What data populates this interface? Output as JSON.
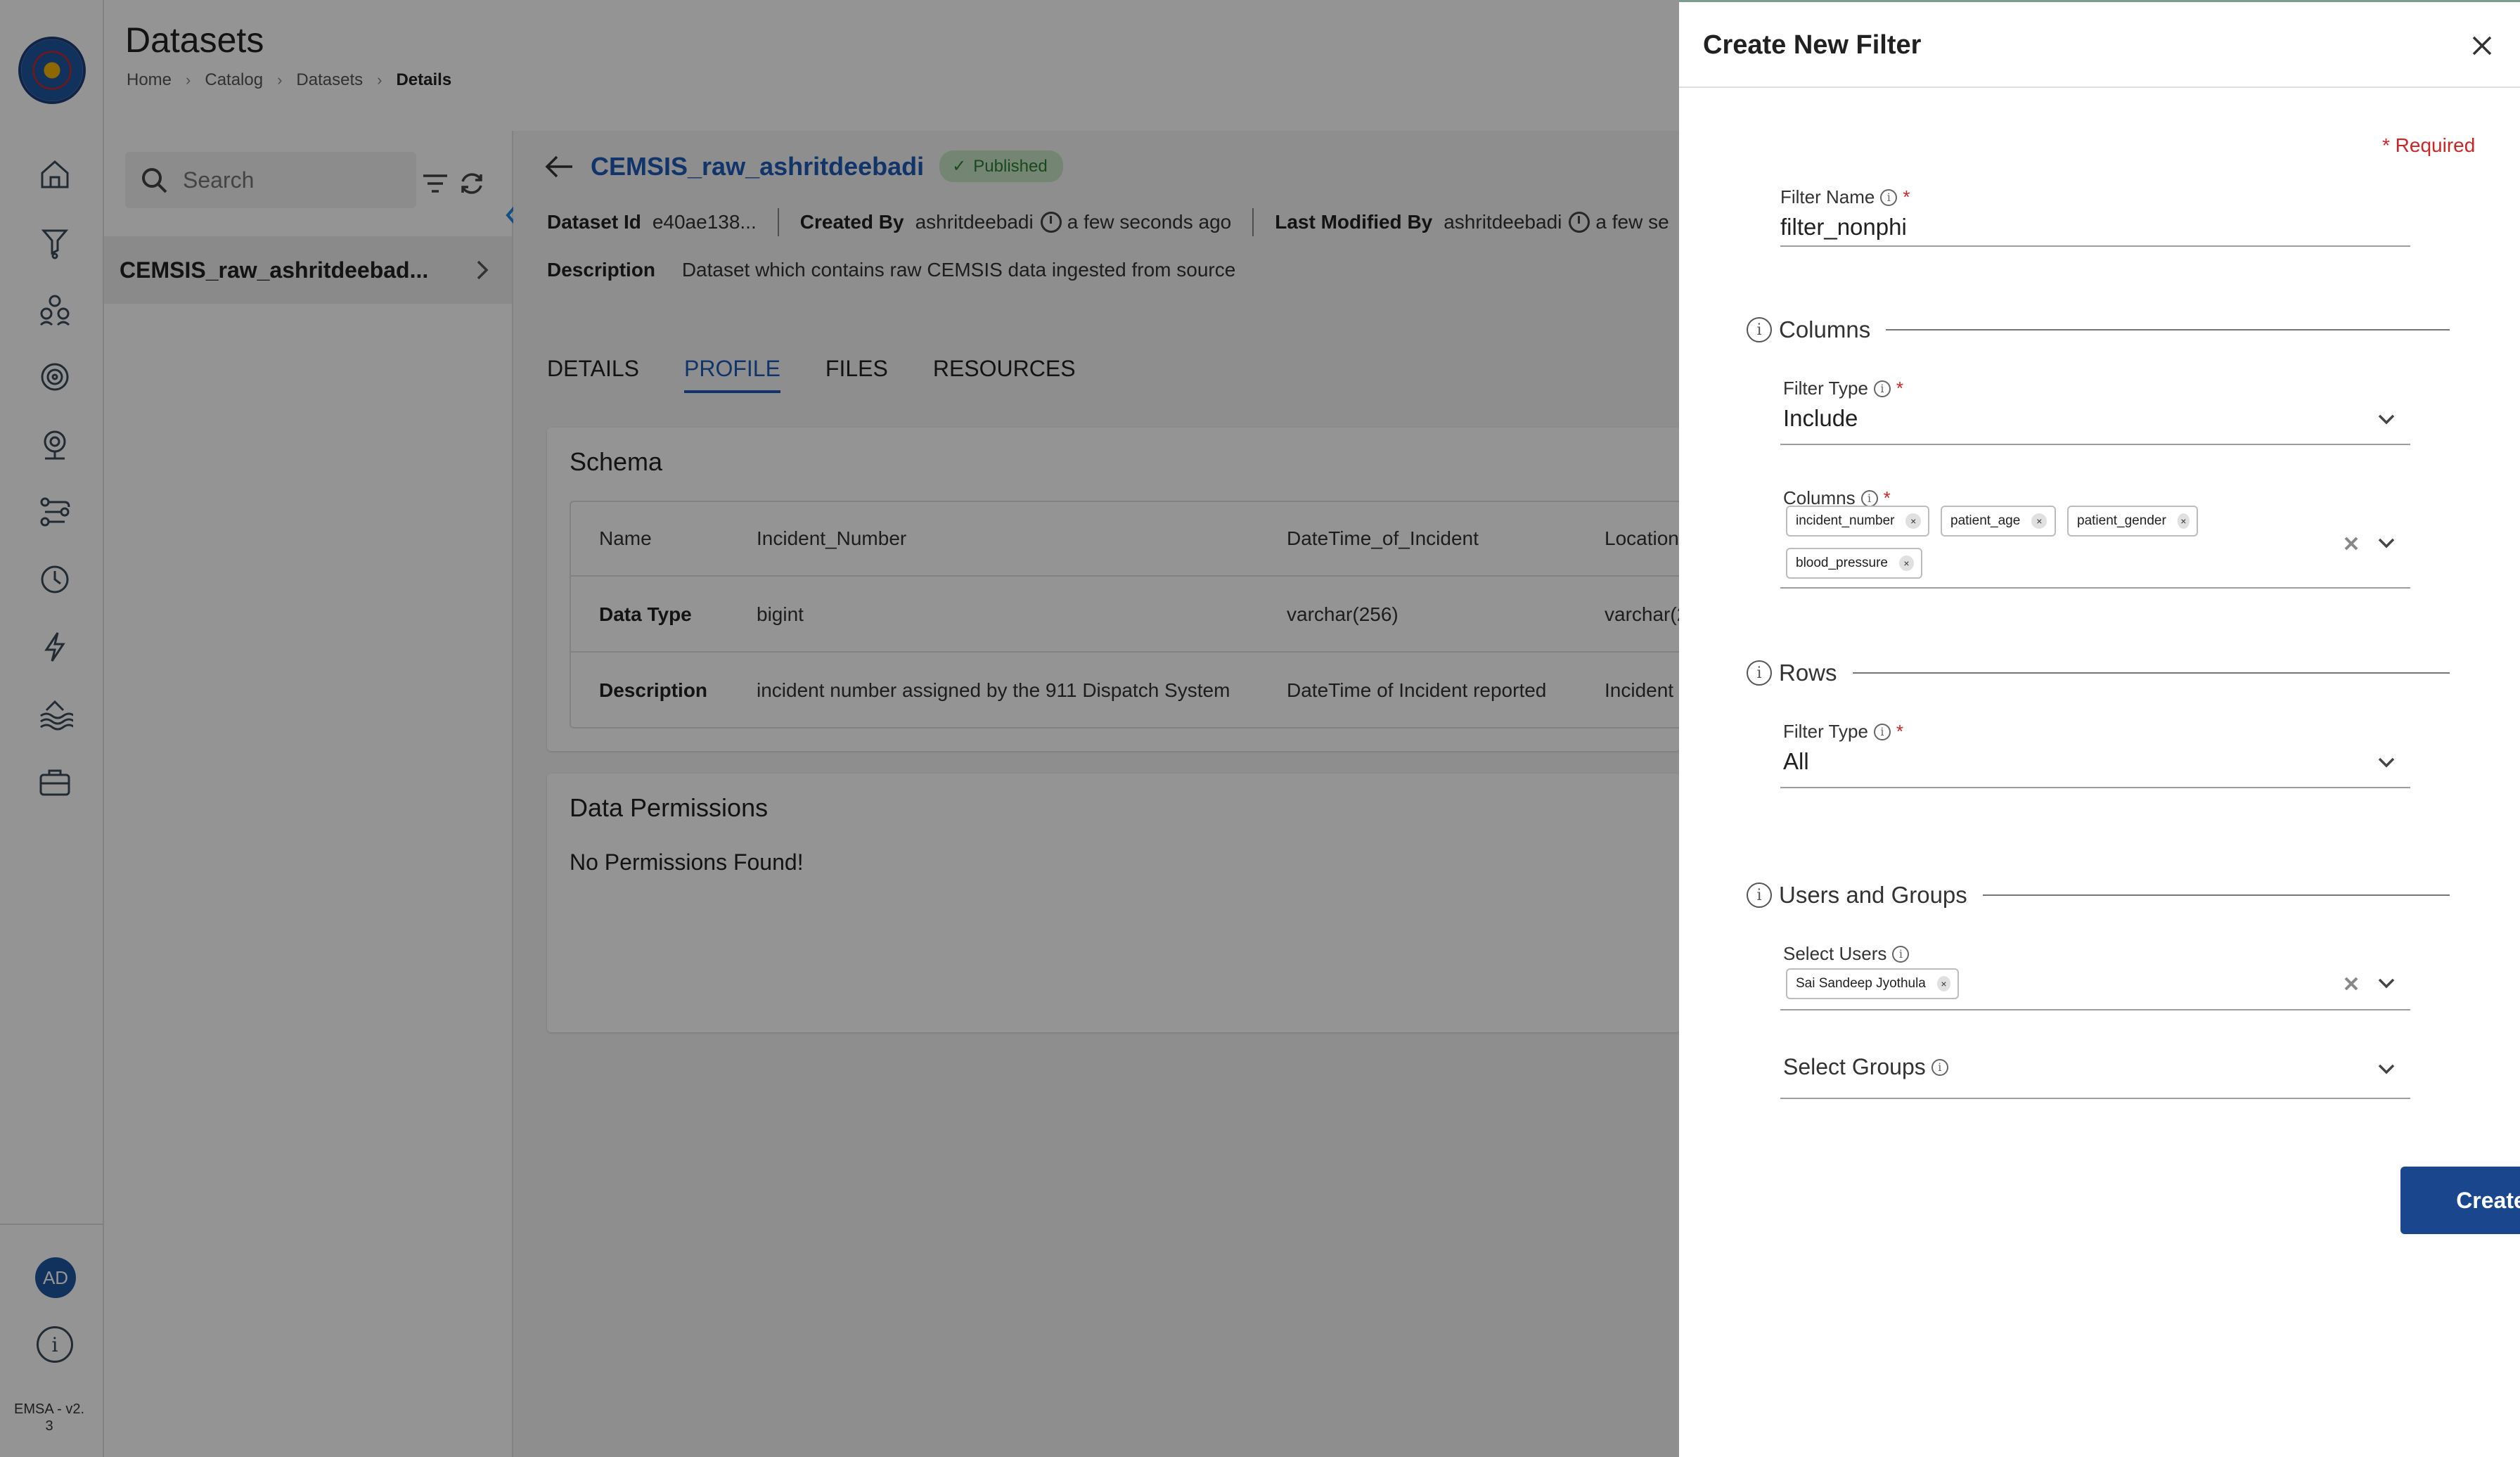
{
  "app": {
    "version": "EMSA - v2.\n3",
    "avatar_initials": "AD",
    "logo_name": "emsa-logo"
  },
  "header": {
    "title": "Datasets",
    "breadcrumb": [
      "Home",
      "Catalog",
      "Datasets",
      "Details"
    ]
  },
  "list_panel": {
    "search_placeholder": "Search",
    "items": [
      {
        "label": "CEMSIS_raw_ashritdeebad..."
      }
    ]
  },
  "dataset": {
    "title": "CEMSIS_raw_ashritdeebadi",
    "status": "Published",
    "id_label": "Dataset Id",
    "id_value": "e40ae138...",
    "created_by_label": "Created By",
    "created_by": "ashritdeebadi",
    "created_time": "a few seconds ago",
    "modified_by_label": "Last Modified By",
    "modified_by": "ashritdeebadi",
    "modified_time": "a few se",
    "description_label": "Description",
    "description": "Dataset which contains raw CEMSIS data ingested from source",
    "tabs": [
      {
        "label": "DETAILS",
        "active": false
      },
      {
        "label": "PROFILE",
        "active": true
      },
      {
        "label": "FILES",
        "active": false
      },
      {
        "label": "RESOURCES",
        "active": false
      }
    ],
    "schema": {
      "title": "Schema",
      "rows": [
        {
          "header": "Name",
          "cells": [
            "Incident_Number",
            "DateTime_of_Incident",
            "Location"
          ]
        },
        {
          "header": "Data Type",
          "cells": [
            "bigint",
            "varchar(256)",
            "varchar(2"
          ]
        },
        {
          "header": "Description",
          "cells": [
            "incident number assigned by the 911 Dispatch System",
            "DateTime of Incident reported",
            "Incident"
          ]
        }
      ]
    },
    "permissions": {
      "title": "Data Permissions",
      "empty_text": "No Permissions Found!"
    }
  },
  "drawer": {
    "title": "Create New Filter",
    "required_note": "* Required",
    "filter_name_label": "Filter Name",
    "filter_name_value": "filter_nonphi",
    "columns_section": "Columns",
    "columns_filter_type_label": "Filter Type",
    "columns_filter_type_value": "Include",
    "columns_label": "Columns",
    "columns_selected": [
      "incident_number",
      "patient_age",
      "patient_gender",
      "blood_pressure"
    ],
    "rows_section": "Rows",
    "rows_filter_type_label": "Filter Type",
    "rows_filter_type_value": "All",
    "users_section": "Users and Groups",
    "select_users_label": "Select Users",
    "selected_users": [
      "Sai Sandeep Jyothula"
    ],
    "select_groups_placeholder": "Select Groups",
    "create_label": "Create"
  },
  "colors": {
    "accent": "#1e5ab8",
    "create_button": "#1a468e",
    "required": "#c62828",
    "published_badge_bg": "#c8e6c9",
    "published_badge_text": "#2e7d32"
  }
}
